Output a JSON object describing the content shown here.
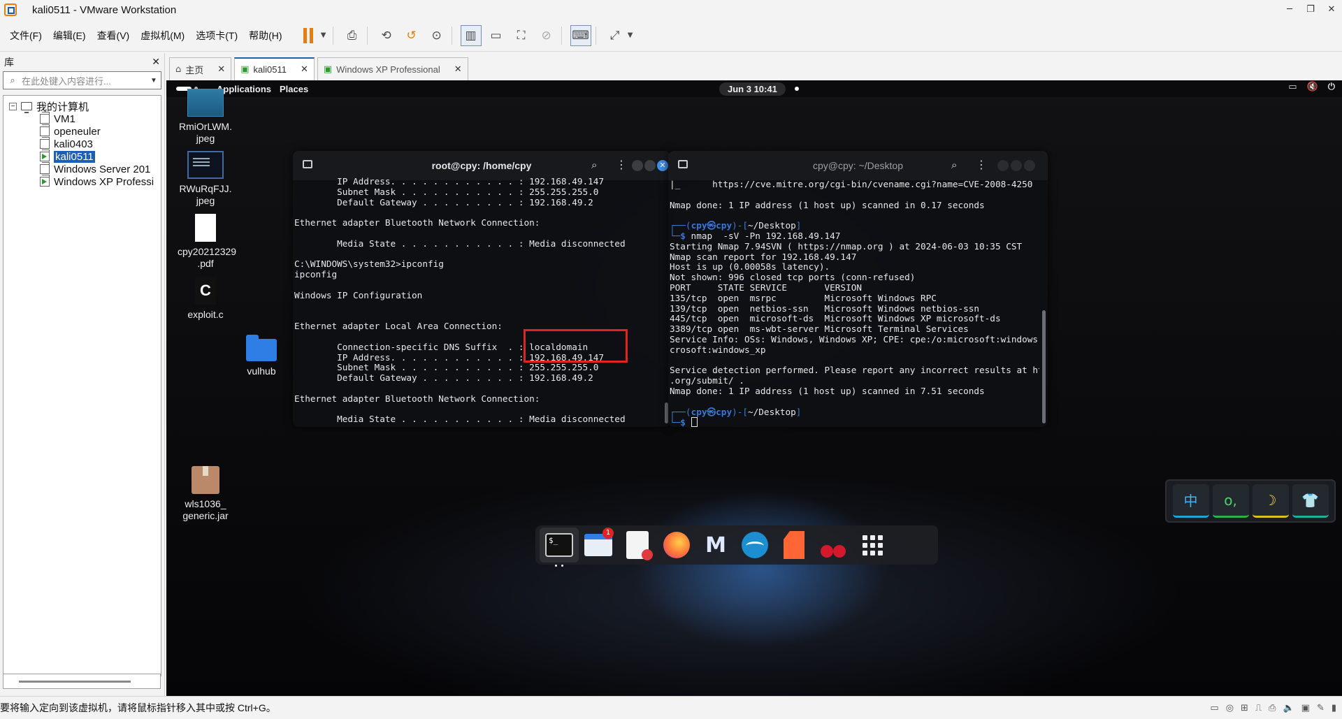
{
  "window": {
    "title": "kali0511 - VMware Workstation",
    "controls": [
      "─",
      "❐",
      "✕"
    ]
  },
  "menu": {
    "items": [
      "文件(F)",
      "编辑(E)",
      "查看(V)",
      "虚拟机(M)",
      "选项卡(T)",
      "帮助(H)"
    ]
  },
  "toolbar": {
    "pause_color": "#e87d0d",
    "icons": [
      "pause-icon",
      "send-ctrl-alt-del-icon",
      "snapshot-icon",
      "revert-snapshot-icon",
      "snapshot-manager-icon",
      "library-view-icon",
      "thumbnail-view-icon",
      "fullscreen-icon",
      "unity-icon",
      "console-icon",
      "stretch-icon"
    ]
  },
  "library": {
    "title": "库",
    "close": "✕",
    "search_placeholder": "在此处键入内容进行...",
    "root": "我的计算机",
    "items": [
      {
        "label": "VM1",
        "running": false
      },
      {
        "label": "openeuler",
        "running": false
      },
      {
        "label": "kali0403",
        "running": false
      },
      {
        "label": "kali0511",
        "running": true,
        "selected": true
      },
      {
        "label": "Windows Server 201",
        "running": false
      },
      {
        "label": "Windows XP Professi",
        "running": true
      }
    ]
  },
  "tabs": [
    {
      "label": "主页",
      "icon": "home-icon",
      "active": false
    },
    {
      "label": "kali0511",
      "icon": "vm-icon",
      "active": true
    },
    {
      "label": "Windows XP Professional",
      "icon": "vm-icon",
      "active": false
    }
  ],
  "guest": {
    "topbar": {
      "applications": "Applications",
      "places": "Places",
      "clock": "Jun 3  10:41"
    },
    "desktop_icons": [
      {
        "label": "RmiOrLWM.\njpeg",
        "kind": "img1"
      },
      {
        "label": "RWuRqFJJ.\njpeg",
        "kind": "img2"
      },
      {
        "label": "cpy20212329\n.pdf",
        "kind": "pdf"
      },
      {
        "label": "exploit.c",
        "kind": "cfile",
        "glyph": "C"
      },
      {
        "label": "vulhub",
        "kind": "folder"
      },
      {
        "label": "wls1036_\ngeneric.jar",
        "kind": "jar"
      }
    ],
    "terminal_left": {
      "title": "root@cpy: /home/cpy",
      "lines": [
        "        IP Address. . . . . . . . . . . . : 192.168.49.147",
        "        Subnet Mask . . . . . . . . . . . : 255.255.255.0",
        "        Default Gateway . . . . . . . . . : 192.168.49.2",
        "",
        "Ethernet adapter Bluetooth Network Connection:",
        "",
        "        Media State . . . . . . . . . . . : Media disconnected",
        "",
        "C:\\WINDOWS\\system32>ipconfig",
        "ipconfig",
        "",
        "Windows IP Configuration",
        "",
        "",
        "Ethernet adapter Local Area Connection:",
        "",
        "        Connection-specific DNS Suffix  . : localdomain",
        "        IP Address. . . . . . . . . . . . : 192.168.49.147",
        "        Subnet Mask . . . . . . . . . . . : 255.255.255.0",
        "        Default Gateway . . . . . . . . . : 192.168.49.2",
        "",
        "Ethernet adapter Bluetooth Network Connection:",
        "",
        "        Media State . . . . . . . . . . . : Media disconnected"
      ]
    },
    "terminal_right": {
      "title": "cpy@cpy: ~/Desktop",
      "lines": [
        {
          "t": "|_      https://cve.mitre.org/cgi-bin/cvename.cgi?name=CVE-2008-4250"
        },
        {
          "t": ""
        },
        {
          "t": "Nmap done: 1 IP address (1 host up) scanned in 0.17 seconds"
        },
        {
          "t": ""
        },
        {
          "p1": "┌──(",
          "user": "cpy㉿cpy",
          "p2": ")-[",
          "dir": "~/Desktop",
          "p3": "]"
        },
        {
          "p1": "└─",
          "sym": "$",
          "cmd": " nmap  -sV -Pn 192.168.49.147"
        },
        {
          "t": "Starting Nmap 7.94SVN ( https://nmap.org ) at 2024-06-03 10:35 CST"
        },
        {
          "t": "Nmap scan report for 192.168.49.147"
        },
        {
          "t": "Host is up (0.00058s latency)."
        },
        {
          "t": "Not shown: 996 closed tcp ports (conn-refused)"
        },
        {
          "t": "PORT     STATE SERVICE       VERSION"
        },
        {
          "t": "135/tcp  open  msrpc         Microsoft Windows RPC"
        },
        {
          "t": "139/tcp  open  netbios-ssn   Microsoft Windows netbios-ssn"
        },
        {
          "t": "445/tcp  open  microsoft-ds  Microsoft Windows XP microsoft-ds"
        },
        {
          "t": "3389/tcp open  ms-wbt-server Microsoft Terminal Services"
        },
        {
          "t": "Service Info: OSs: Windows, Windows XP; CPE: cpe:/o:microsoft:windows, cpe:/o:mi"
        },
        {
          "t": "crosoft:windows_xp"
        },
        {
          "t": ""
        },
        {
          "t": "Service detection performed. Please report any incorrect results at https://nmap"
        },
        {
          "t": ".org/submit/ ."
        },
        {
          "t": "Nmap done: 1 IP address (1 host up) scanned in 7.51 seconds"
        },
        {
          "t": ""
        },
        {
          "p1": "┌──(",
          "user": "cpy㉿cpy",
          "p2": ")-[",
          "dir": "~/Desktop",
          "p3": "]"
        },
        {
          "p1": "└─",
          "sym": "$",
          "cmd": " ",
          "cursor": true
        }
      ]
    },
    "dock": {
      "items": [
        "terminal-icon",
        "files-icon",
        "text-editor-icon",
        "firefox-icon",
        "metasploit-icon",
        "wireshark-icon",
        "burpsuite-icon",
        "cherrytree-icon",
        "app-grid-icon"
      ],
      "files_badge": "1",
      "terminal_glyph": "$_"
    },
    "ime": {
      "keys": [
        "中",
        "o,",
        "☽",
        "👕"
      ]
    }
  },
  "statusbar": {
    "text": "要将输入定向到该虚拟机，请将鼠标指针移入其中或按 Ctrl+G。"
  }
}
